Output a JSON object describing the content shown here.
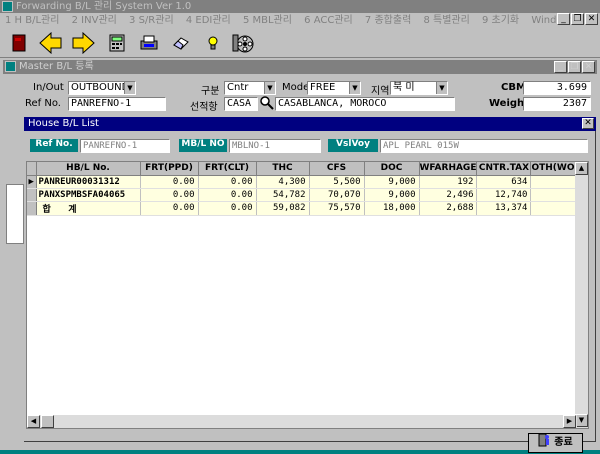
{
  "app": {
    "title": "Forwarding B/L 관리 System Ver 1.0",
    "menu": [
      "1 H B/L관리",
      "2 INV관리",
      "3 S/R관리",
      "4 EDI관리",
      "5 MBL관리",
      "6 ACC관리",
      "7 종합출력",
      "8 특별관리",
      "9 초기화",
      "Window"
    ]
  },
  "master": {
    "title": "Master B/L 등록",
    "inout_label": "In/Out",
    "inout_value": "OUTBOUND",
    "gubun_label": "구분",
    "gubun_value": "Cntr",
    "mode_label": "Mode",
    "mode_value": "FREE",
    "region_label": "지역",
    "region_value": "북   미",
    "cbm_label": "CBM",
    "cbm_value": "3.699",
    "refno_label": "Ref No.",
    "refno_value": "PANREFNO-1",
    "port_label": "선적항",
    "port_code": "CASA",
    "port_name": "CASABLANCA, MOROCO",
    "weight_label": "Weight",
    "weight_value": "2307"
  },
  "dialog": {
    "title": "House B/L List",
    "refno_label": "Ref No.",
    "refno_value": "PANREFNO-1",
    "mbl_label": "MB/L NO",
    "mbl_value": "MBLNO-1",
    "vsl_label": "VslVoy",
    "vsl_value": "APL PEARL 015W",
    "columns": [
      "HB/L No.",
      "FRT(PPD)",
      "FRT(CLT)",
      "THC",
      "CFS",
      "DOC",
      "WFARHAGE",
      "CNTR.TAX",
      "OTH(WON)"
    ],
    "rows": [
      {
        "hbl": "PANREUR00031312",
        "ppd": "0.00",
        "clt": "0.00",
        "thc": "4,300",
        "cfs": "5,500",
        "doc": "9,000",
        "wf": "192",
        "tax": "634",
        "oth": ""
      },
      {
        "hbl": "PANXSPMBSFA04065",
        "ppd": "0.00",
        "clt": "0.00",
        "thc": "54,782",
        "cfs": "70,070",
        "doc": "9,000",
        "wf": "2,496",
        "tax": "12,740",
        "oth": ""
      }
    ],
    "total": {
      "label": "합 계",
      "ppd": "0.00",
      "clt": "0.00",
      "thc": "59,082",
      "cfs": "75,570",
      "doc": "18,000",
      "wf": "2,688",
      "tax": "13,374",
      "oth": ""
    },
    "close_label": "종료"
  }
}
